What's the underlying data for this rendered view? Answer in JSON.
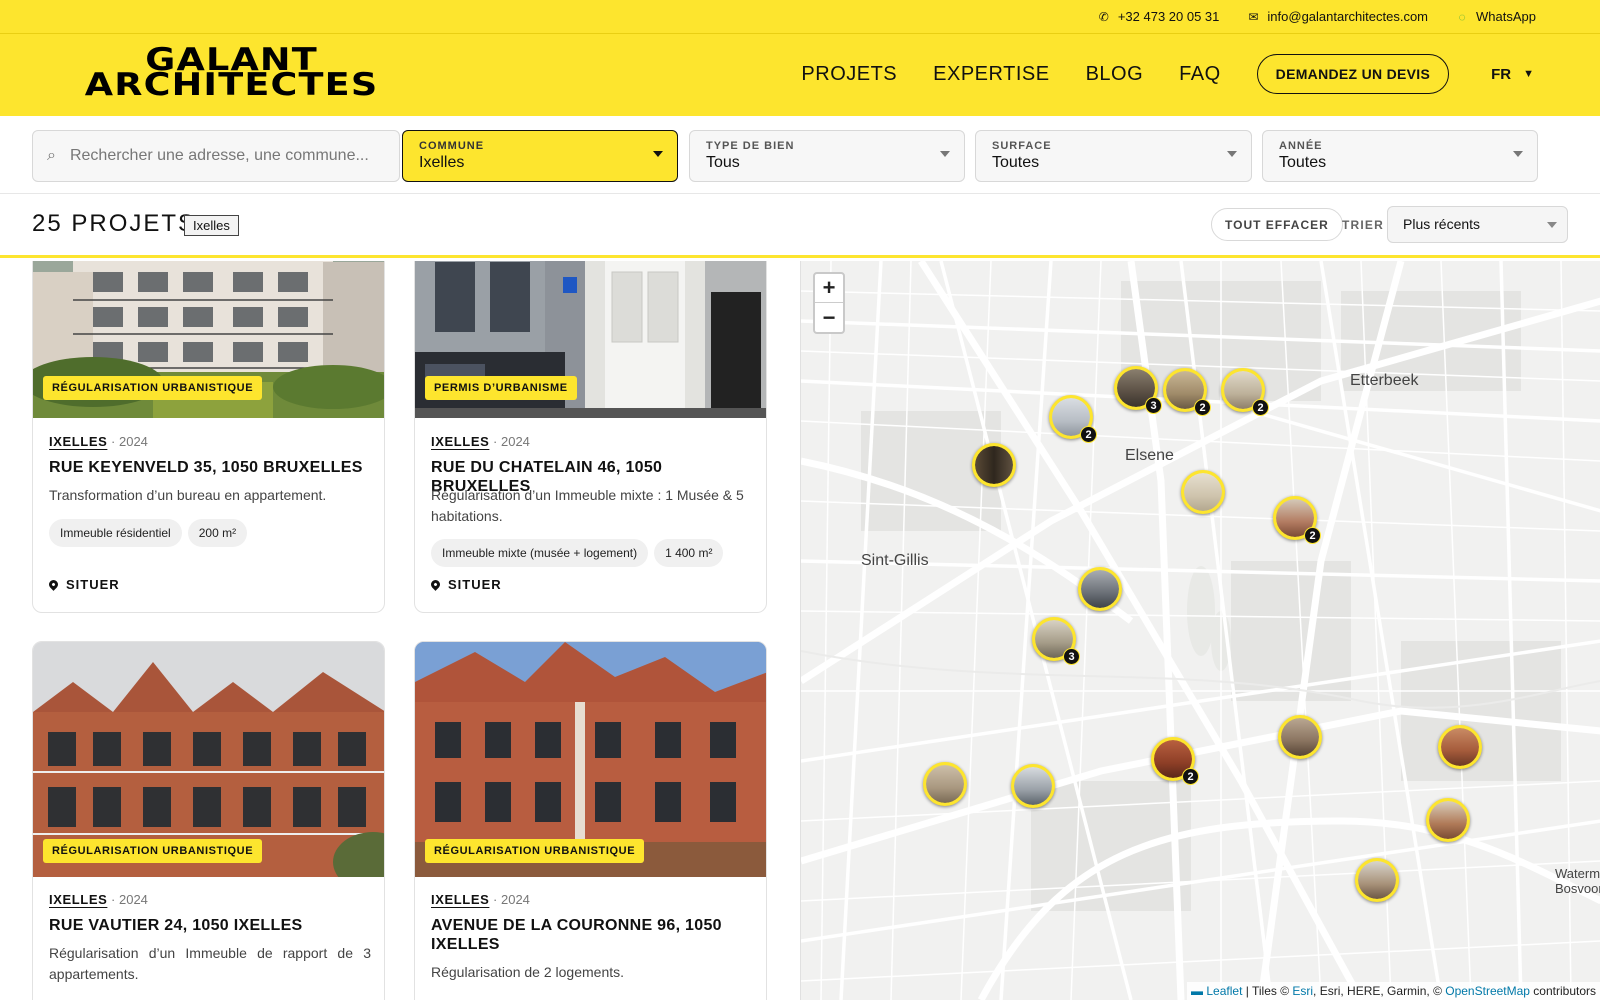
{
  "topbar": {
    "phone": "+32 473 20 05 31",
    "email": "info@galantarchitectes.com",
    "whatsapp": "WhatsApp",
    "phone_icon": "phone-icon",
    "email_icon": "mail-icon",
    "whatsapp_icon": "whatsapp-icon"
  },
  "header": {
    "logo_line1": "GALANT",
    "logo_line2": "ARCHITECTES",
    "nav": [
      "PROJETS",
      "EXPERTISE",
      "BLOG",
      "FAQ"
    ],
    "cta": "DEMANDEZ UN DEVIS",
    "lang": "FR",
    "lang_caret": "▼"
  },
  "filters": {
    "search_placeholder": "Rechercher une adresse, une commune...",
    "search_icon": "search-icon",
    "commune": {
      "label": "COMMUNE",
      "value": "Ixelles"
    },
    "type": {
      "label": "TYPE DE BIEN",
      "value": "Tous"
    },
    "surface": {
      "label": "SURFACE",
      "value": "Toutes"
    },
    "annee": {
      "label": "ANNÉE",
      "value": "Toutes"
    }
  },
  "results": {
    "count": "25 PROJETS",
    "active_chip": "Ixelles",
    "clear": "TOUT EFFACER",
    "sort_label": "TRIER",
    "sort_value": "Plus récents"
  },
  "projects": [
    {
      "badge": "RÉGULARISATION URBANISTIQUE",
      "city": "IXELLES",
      "sep": "·",
      "year": "2024",
      "title": "RUE KEYENVELD 35, 1050 BRUXELLES",
      "desc": "Transformation d’un bureau en appartement.",
      "tags": [
        "Immeuble résidentiel",
        "200 m²"
      ],
      "action": "SITUER"
    },
    {
      "badge": "PERMIS D’URBANISME",
      "city": "IXELLES",
      "sep": "·",
      "year": "2024",
      "title": "RUE DU CHATELAIN 46, 1050 BRUXELLES",
      "desc": "Régularisation d’un Immeuble mixte : 1 Musée & 5 habitations.",
      "tags": [
        "Immeuble mixte (musée + logement)",
        "1 400 m²"
      ],
      "action": "SITUER"
    },
    {
      "badge": "RÉGULARISATION URBANISTIQUE",
      "city": "IXELLES",
      "sep": "·",
      "year": "2024",
      "title": "RUE VAUTIER 24, 1050 IXELLES",
      "desc": "Régularisation d’un Immeuble de rapport de 3 appartements."
    },
    {
      "badge": "RÉGULARISATION URBANISTIQUE",
      "city": "IXELLES",
      "sep": "·",
      "year": "2024",
      "title": "AVENUE DE LA COURONNE 96, 1050 IXELLES",
      "desc": "Régularisation de 2 logements."
    }
  ],
  "map": {
    "zoom_in": "+",
    "zoom_out": "−",
    "places": [
      "Etterbeek",
      "Elsene",
      "Sint-Gillis",
      "Waterma",
      "Bosvoor"
    ],
    "cluster_counts": [
      "3",
      "2",
      "2",
      "2",
      "2",
      "3",
      "2"
    ],
    "attribution": {
      "leaflet": "Leaflet",
      "sep1": " | Tiles © ",
      "esri": "Esri",
      "rest": ", Esri, HERE, Garmin, © ",
      "osm": "OpenStreetMap",
      "tail": " contributors"
    }
  },
  "colors": {
    "brand_yellow": "#fde52e",
    "text": "#111111",
    "map_bg": "#f1f1f0"
  }
}
